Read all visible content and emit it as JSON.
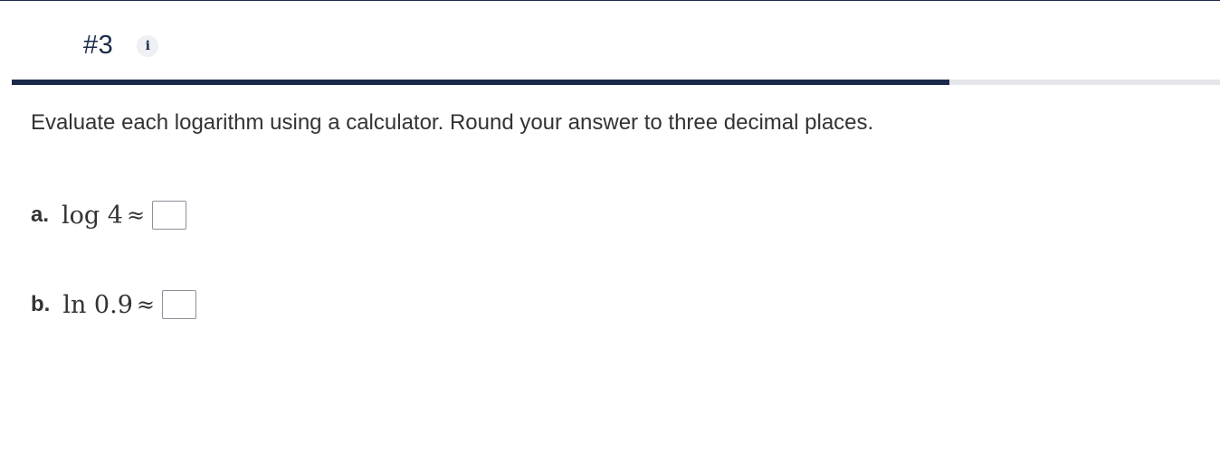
{
  "question": {
    "number": "#3",
    "info_icon": "info-icon",
    "info_glyph": "i"
  },
  "progress": {
    "fraction": 0.776,
    "fill_color": "#1b2a4a",
    "track_color": "#e4e6e9"
  },
  "instructions": "Evaluate each logarithm using a calculator. Round your answer to three decimal places.",
  "items": [
    {
      "label": "a.",
      "expression": "log 4",
      "symbol": "≈",
      "answer": ""
    },
    {
      "label": "b.",
      "expression": "ln 0.9",
      "symbol": "≈",
      "answer": ""
    }
  ]
}
